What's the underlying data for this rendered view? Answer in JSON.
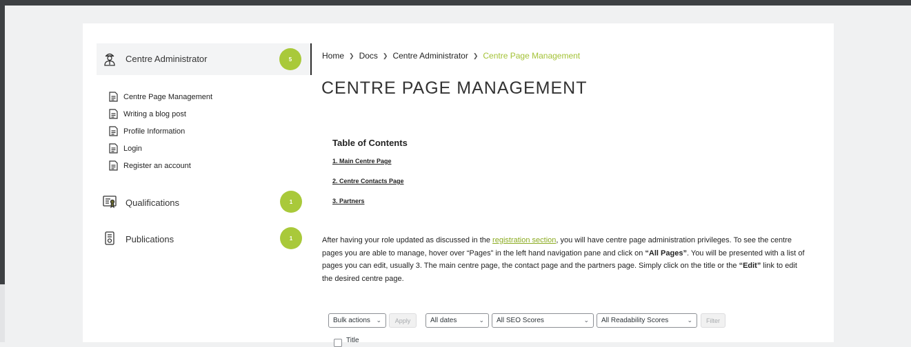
{
  "sidebar": {
    "sections": [
      {
        "label": "Centre Administrator",
        "badge": "5",
        "icon": "administrator-icon"
      },
      {
        "label": "Qualifications",
        "badge": "1",
        "icon": "certificate-icon"
      },
      {
        "label": "Publications",
        "badge": "1",
        "icon": "document-stack-icon"
      }
    ],
    "pages": [
      {
        "label": "Centre Page Management"
      },
      {
        "label": "Writing a blog post"
      },
      {
        "label": "Profile Information"
      },
      {
        "label": "Login"
      },
      {
        "label": "Register an account"
      }
    ]
  },
  "breadcrumb": {
    "home": "Home",
    "docs": "Docs",
    "section": "Centre Administrator",
    "current": "Centre Page Management",
    "separator": "❯"
  },
  "page": {
    "title": "CENTRE PAGE MANAGEMENT"
  },
  "toc": {
    "title": "Table of Contents",
    "items": [
      "1. Main Centre Page",
      "2. Centre Contacts Page",
      "3. Partners"
    ]
  },
  "body": {
    "p1": "After having your role updated as discussed in the ",
    "link": "registration section",
    "p2": ", you will have centre page administration privileges. To see the centre pages you are able to manage, hover over “Pages” in the left hand navigation pane and click on ",
    "b1": "“All Pages”",
    "p3": ". You will be presented with a list of pages you can edit, usually 3. The main centre page, the contact page and the partners page. Simply click on the title or the ",
    "b2": "“Edit”",
    "p4": " link to edit the desired centre page."
  },
  "screenshot_toolbar": {
    "bulk_actions": "Bulk actions",
    "apply": "Apply",
    "dates": "All dates",
    "seo": "All SEO Scores",
    "readability": "All Readability Scores",
    "filter": "Filter",
    "title_col": "Title"
  },
  "colors": {
    "accent": "#a9c93a",
    "link": "#8aaa1f",
    "chrome": "#3d4043"
  }
}
